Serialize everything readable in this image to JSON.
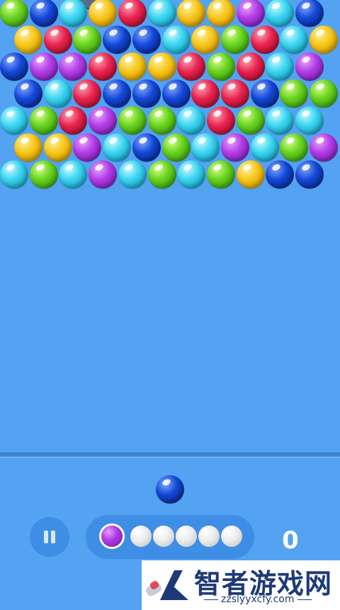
{
  "colors": {
    "background": "#53a3f2",
    "bubbles": {
      "Y": [
        "#fff1a0",
        "#f7c516",
        "#c98c00"
      ],
      "B": [
        "#7fa6ff",
        "#1347d6",
        "#051f7a"
      ],
      "C": [
        "#c6fbff",
        "#37d3f0",
        "#0f8db0"
      ],
      "R": [
        "#ff9fb1",
        "#e8224e",
        "#9d0724"
      ],
      "P": [
        "#e7a4ff",
        "#b23be6",
        "#7216a6"
      ],
      "G": [
        "#d4ff8a",
        "#66d11d",
        "#2f8e08"
      ]
    }
  },
  "board": {
    "rows": [
      [
        "G",
        "B",
        "C",
        "Y",
        "R",
        "C",
        "Y",
        "Y",
        "P",
        "C",
        "B"
      ],
      [
        "Y",
        "R",
        "G",
        "B",
        "B",
        "C",
        "Y",
        "G",
        "R",
        "C",
        "Y"
      ],
      [
        "B",
        "P",
        "P",
        "R",
        "Y",
        "Y",
        "R",
        "G",
        "R",
        "C",
        "P"
      ],
      [
        "B",
        "C",
        "R",
        "B",
        "B",
        "B",
        "R",
        "R",
        "B",
        "G",
        "G"
      ],
      [
        "C",
        "G",
        "R",
        "P",
        "G",
        "G",
        "C",
        "R",
        "G",
        "C",
        "C"
      ],
      [
        "Y",
        "Y",
        "P",
        "C",
        "B",
        "G",
        "C",
        "P",
        "C",
        "G",
        "P"
      ],
      [
        "C",
        "G",
        "C",
        "P",
        "C",
        "G",
        "C",
        "G",
        "Y",
        "B",
        "B"
      ]
    ]
  },
  "shooter": {
    "current_color": "B",
    "icon": "blue-bubble"
  },
  "queue": {
    "next_color": "P",
    "remaining_shots": 5
  },
  "pause": {
    "icon": "pause-icon"
  },
  "score": {
    "value": "0"
  },
  "watermark": {
    "title": "智者游戏网",
    "url": "zzslyyxcfy.com"
  }
}
